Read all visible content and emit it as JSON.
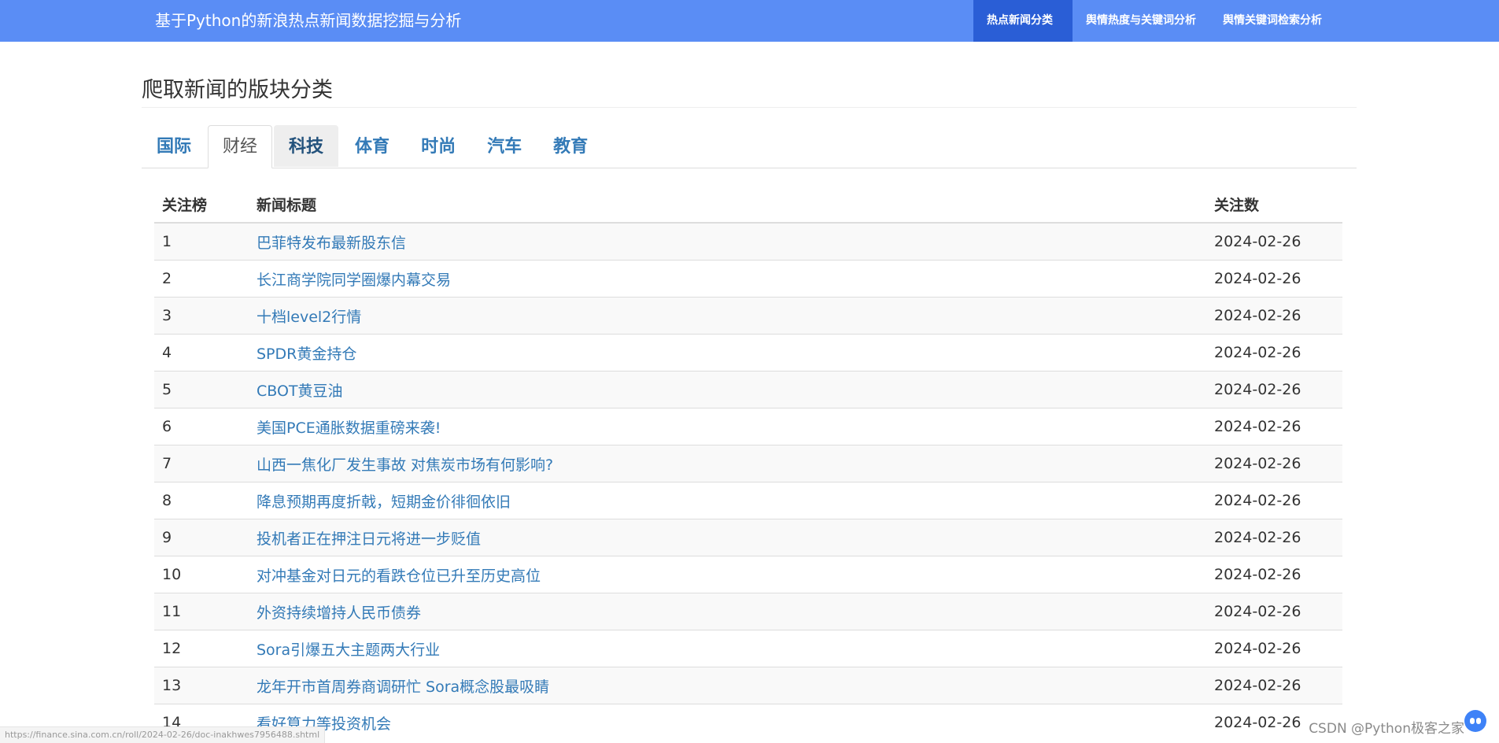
{
  "navbar": {
    "brand": "基于Python的新浪热点新闻数据挖掘与分析",
    "links": [
      {
        "label": "热点新闻分类",
        "active": true
      },
      {
        "label": "舆情热度与关键词分析",
        "active": false
      },
      {
        "label": "舆情关键词检索分析",
        "active": false
      }
    ]
  },
  "page": {
    "title": "爬取新闻的版块分类"
  },
  "tabs": [
    {
      "label": "国际"
    },
    {
      "label": "财经"
    },
    {
      "label": "科技"
    },
    {
      "label": "体育"
    },
    {
      "label": "时尚"
    },
    {
      "label": "汽车"
    },
    {
      "label": "教育"
    }
  ],
  "table": {
    "headers": {
      "rank": "关注榜",
      "title": "新闻标题",
      "count": "关注数"
    },
    "rows": [
      {
        "rank": "1",
        "title": "巴菲特发布最新股东信",
        "count": "2024-02-26"
      },
      {
        "rank": "2",
        "title": "长江商学院同学圈爆内幕交易",
        "count": "2024-02-26"
      },
      {
        "rank": "3",
        "title": "十档level2行情",
        "count": "2024-02-26"
      },
      {
        "rank": "4",
        "title": "SPDR黄金持仓",
        "count": "2024-02-26"
      },
      {
        "rank": "5",
        "title": "CBOT黄豆油",
        "count": "2024-02-26"
      },
      {
        "rank": "6",
        "title": "美国PCE通胀数据重磅来袭!",
        "count": "2024-02-26"
      },
      {
        "rank": "7",
        "title": "山西一焦化厂发生事故 对焦炭市场有何影响?",
        "count": "2024-02-26"
      },
      {
        "rank": "8",
        "title": "降息预期再度折戟，短期金价徘徊依旧",
        "count": "2024-02-26"
      },
      {
        "rank": "9",
        "title": "投机者正在押注日元将进一步贬值",
        "count": "2024-02-26"
      },
      {
        "rank": "10",
        "title": "对冲基金对日元的看跌仓位已升至历史高位",
        "count": "2024-02-26"
      },
      {
        "rank": "11",
        "title": "外资持续增持人民币债券",
        "count": "2024-02-26"
      },
      {
        "rank": "12",
        "title": "Sora引爆五大主题两大行业",
        "count": "2024-02-26"
      },
      {
        "rank": "13",
        "title": "龙年开市首周券商调研忙 Sora概念股最吸睛",
        "count": "2024-02-26"
      },
      {
        "rank": "14",
        "title": "看好算力等投资机会",
        "count": "2024-02-26"
      }
    ]
  },
  "status_bar": {
    "url": "https://finance.sina.com.cn/roll/2024-02-26/doc-inakhwes7956488.shtml"
  },
  "watermark": {
    "text": "CSDN @Python极客之家"
  },
  "colors": {
    "navbar": "#5a8df5",
    "navbar_active": "#2a5ed6",
    "link": "#337ab7"
  }
}
